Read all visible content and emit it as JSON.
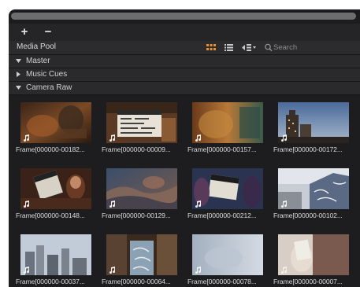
{
  "toolbar": {
    "add_icon": "plus-icon",
    "remove_icon": "minus-icon",
    "add_label": "+",
    "remove_label": "−"
  },
  "header": {
    "title": "Media Pool",
    "views": [
      "thumbnail-view-icon",
      "list-view-icon",
      "sort-view-icon"
    ],
    "search_placeholder": "Search",
    "accent": "#e8902c"
  },
  "bins": [
    {
      "label": "Master",
      "expanded": true
    },
    {
      "label": "Music Cues",
      "expanded": false
    },
    {
      "label": "Camera Raw",
      "expanded": true
    }
  ],
  "clips": [
    {
      "name": "Frame[000000-00182..."
    },
    {
      "name": "Frame[000000-00009..."
    },
    {
      "name": "Frame[000000-00157..."
    },
    {
      "name": "Frame[000000-00172..."
    },
    {
      "name": "Frame[000000-00148..."
    },
    {
      "name": "Frame[000000-00129..."
    },
    {
      "name": "Frame[000000-00212..."
    },
    {
      "name": "Frame[000000-00102..."
    },
    {
      "name": "Frame[000000-00037..."
    },
    {
      "name": "Frame[000000-00064..."
    },
    {
      "name": "Frame[000000-00078..."
    },
    {
      "name": "Frame[000000-00007..."
    }
  ]
}
